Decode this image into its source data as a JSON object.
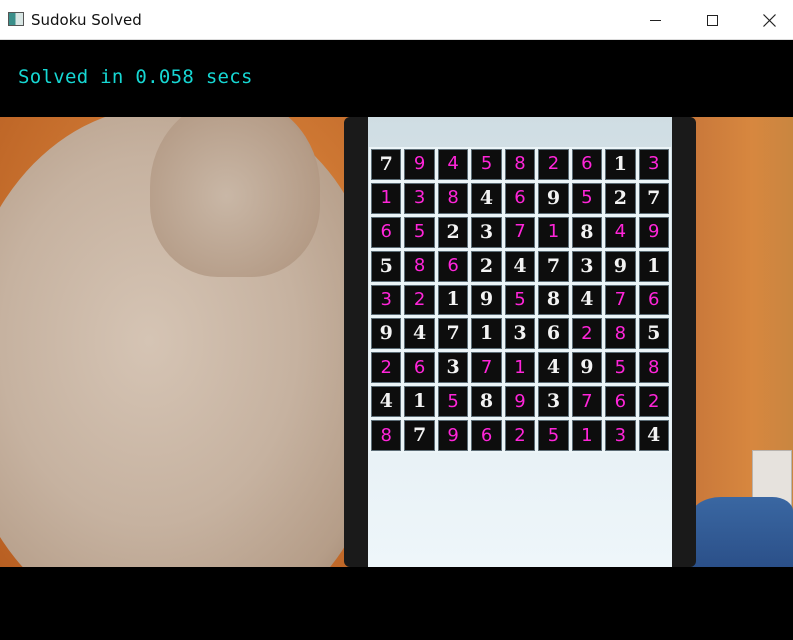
{
  "window": {
    "title": "Sudoku Solved",
    "controls": {
      "minimize": "minimize",
      "maximize": "maximize",
      "close": "close"
    }
  },
  "status": {
    "text": "Solved in 0.058 secs",
    "color": "#16d7d3"
  },
  "colors": {
    "given_digit": "#f3f3f3",
    "solved_digit": "#ff25d9"
  },
  "sudoku": {
    "rows": [
      [
        {
          "v": "7",
          "g": true
        },
        {
          "v": "9",
          "g": false
        },
        {
          "v": "4",
          "g": false
        },
        {
          "v": "5",
          "g": false
        },
        {
          "v": "8",
          "g": false
        },
        {
          "v": "2",
          "g": false
        },
        {
          "v": "6",
          "g": false
        },
        {
          "v": "1",
          "g": true
        },
        {
          "v": "3",
          "g": false
        }
      ],
      [
        {
          "v": "1",
          "g": false
        },
        {
          "v": "3",
          "g": false
        },
        {
          "v": "8",
          "g": false
        },
        {
          "v": "4",
          "g": true
        },
        {
          "v": "6",
          "g": false
        },
        {
          "v": "9",
          "g": true
        },
        {
          "v": "5",
          "g": false
        },
        {
          "v": "2",
          "g": true
        },
        {
          "v": "7",
          "g": true
        }
      ],
      [
        {
          "v": "6",
          "g": false
        },
        {
          "v": "5",
          "g": false
        },
        {
          "v": "2",
          "g": true
        },
        {
          "v": "3",
          "g": true
        },
        {
          "v": "7",
          "g": false
        },
        {
          "v": "1",
          "g": false
        },
        {
          "v": "8",
          "g": true
        },
        {
          "v": "4",
          "g": false
        },
        {
          "v": "9",
          "g": false
        }
      ],
      [
        {
          "v": "5",
          "g": true
        },
        {
          "v": "8",
          "g": false
        },
        {
          "v": "6",
          "g": false
        },
        {
          "v": "2",
          "g": true
        },
        {
          "v": "4",
          "g": true
        },
        {
          "v": "7",
          "g": true
        },
        {
          "v": "3",
          "g": true
        },
        {
          "v": "9",
          "g": true
        },
        {
          "v": "1",
          "g": true
        }
      ],
      [
        {
          "v": "3",
          "g": false
        },
        {
          "v": "2",
          "g": false
        },
        {
          "v": "1",
          "g": true
        },
        {
          "v": "9",
          "g": true
        },
        {
          "v": "5",
          "g": false
        },
        {
          "v": "8",
          "g": true
        },
        {
          "v": "4",
          "g": true
        },
        {
          "v": "7",
          "g": false
        },
        {
          "v": "6",
          "g": false
        }
      ],
      [
        {
          "v": "9",
          "g": true
        },
        {
          "v": "4",
          "g": true
        },
        {
          "v": "7",
          "g": true
        },
        {
          "v": "1",
          "g": true
        },
        {
          "v": "3",
          "g": true
        },
        {
          "v": "6",
          "g": true
        },
        {
          "v": "2",
          "g": false
        },
        {
          "v": "8",
          "g": false
        },
        {
          "v": "5",
          "g": true
        }
      ],
      [
        {
          "v": "2",
          "g": false
        },
        {
          "v": "6",
          "g": false
        },
        {
          "v": "3",
          "g": true
        },
        {
          "v": "7",
          "g": false
        },
        {
          "v": "1",
          "g": false
        },
        {
          "v": "4",
          "g": true
        },
        {
          "v": "9",
          "g": true
        },
        {
          "v": "5",
          "g": false
        },
        {
          "v": "8",
          "g": false
        }
      ],
      [
        {
          "v": "4",
          "g": true
        },
        {
          "v": "1",
          "g": true
        },
        {
          "v": "5",
          "g": false
        },
        {
          "v": "8",
          "g": true
        },
        {
          "v": "9",
          "g": false
        },
        {
          "v": "3",
          "g": true
        },
        {
          "v": "7",
          "g": false
        },
        {
          "v": "6",
          "g": false
        },
        {
          "v": "2",
          "g": false
        }
      ],
      [
        {
          "v": "8",
          "g": false
        },
        {
          "v": "7",
          "g": true
        },
        {
          "v": "9",
          "g": false
        },
        {
          "v": "6",
          "g": false
        },
        {
          "v": "2",
          "g": false
        },
        {
          "v": "5",
          "g": false
        },
        {
          "v": "1",
          "g": false
        },
        {
          "v": "3",
          "g": false
        },
        {
          "v": "4",
          "g": true
        }
      ]
    ]
  }
}
